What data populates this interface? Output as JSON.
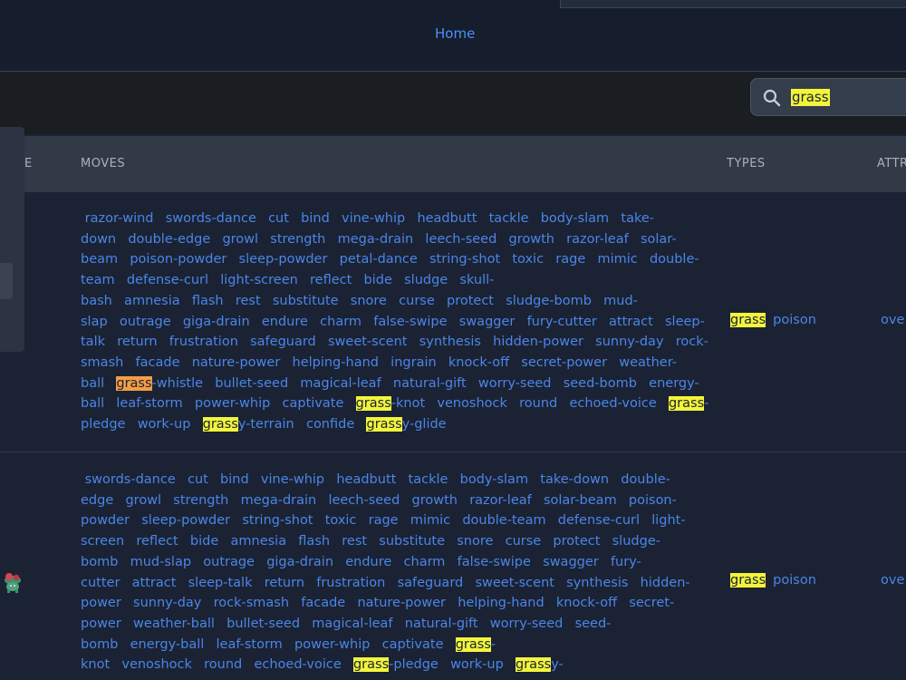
{
  "nav": {
    "home_label": "Home"
  },
  "search": {
    "value": "grass"
  },
  "table": {
    "headers": {
      "name_partial": "E",
      "moves": "MOVES",
      "types": "TYPES",
      "attributes_partial": "ATTR"
    },
    "rows": [
      {
        "moves_lines": [
          [
            " razor-wind  swords-dance  cut  bind  vine-whip  headbutt  tackle  body-slam  take-"
          ],
          [
            "down  double-edge  growl  strength  mega-drain  leech-seed  growth  razor-leaf  solar-"
          ],
          [
            "beam  poison-powder  sleep-powder  petal-dance  string-shot  toxic  rage  mimic  double-"
          ],
          [
            "team  defense-curl  light-screen  reflect  bide  sludge  skull-"
          ],
          [
            "bash  amnesia  flash  rest  substitute  snore  curse  protect  sludge-bomb  mud-"
          ],
          [
            "slap  outrage  giga-drain  endure  charm  false-swipe  swagger  fury-cutter  attract  sleep-"
          ],
          [
            "talk  return  frustration  safeguard  sweet-scent  synthesis  hidden-power  sunny-day  rock-"
          ],
          [
            "smash  facade  nature-power  helping-hand  ingrain  knock-off  secret-power  weather-"
          ],
          [
            "ball  ",
            {
              "hlc": "grass"
            },
            "-whistle  bullet-seed  magical-leaf  natural-gift  worry-seed  seed-bomb  energy-"
          ],
          [
            "ball  leaf-storm  power-whip  captivate  ",
            {
              "hl": "grass"
            },
            "-knot  venoshock  round  echoed-voice  ",
            {
              "hl": "grass"
            },
            "-"
          ],
          [
            "pledge  work-up  ",
            {
              "hl": "grass"
            },
            "y-terrain  confide  ",
            {
              "hl": "grass"
            },
            "y-glide"
          ]
        ],
        "types": [
          "grass",
          "poison"
        ],
        "attr": "ove"
      },
      {
        "moves_lines": [
          [
            " swords-dance  cut  bind  vine-whip  headbutt  tackle  body-slam  take-down  double-"
          ],
          [
            "edge  growl  strength  mega-drain  leech-seed  growth  razor-leaf  solar-beam  poison-"
          ],
          [
            "powder  sleep-powder  string-shot  toxic  rage  mimic  double-team  defense-curl  light-"
          ],
          [
            "screen  reflect  bide  amnesia  flash  rest  substitute  snore  curse  protect  sludge-"
          ],
          [
            "bomb  mud-slap  outrage  giga-drain  endure  charm  false-swipe  swagger  fury-"
          ],
          [
            "cutter  attract  sleep-talk  return  frustration  safeguard  sweet-scent  synthesis  hidden-"
          ],
          [
            "power  sunny-day  rock-smash  facade  nature-power  helping-hand  knock-off  secret-"
          ],
          [
            "power  weather-ball  bullet-seed  magical-leaf  natural-gift  worry-seed  seed-"
          ],
          [
            "bomb  energy-ball  leaf-storm  power-whip  captivate  ",
            {
              "hl": "grass"
            },
            "-"
          ],
          [
            "knot  venoshock  round  echoed-voice  ",
            {
              "hl": "grass"
            },
            "-pledge  work-up  ",
            {
              "hl": "grass"
            },
            "y-"
          ]
        ],
        "types": [
          "grass",
          "poison"
        ],
        "attr": "ove"
      }
    ]
  },
  "colors": {
    "highlight": "#f2f53a",
    "current_highlight": "#f29d46",
    "link": "#4a86e8"
  }
}
